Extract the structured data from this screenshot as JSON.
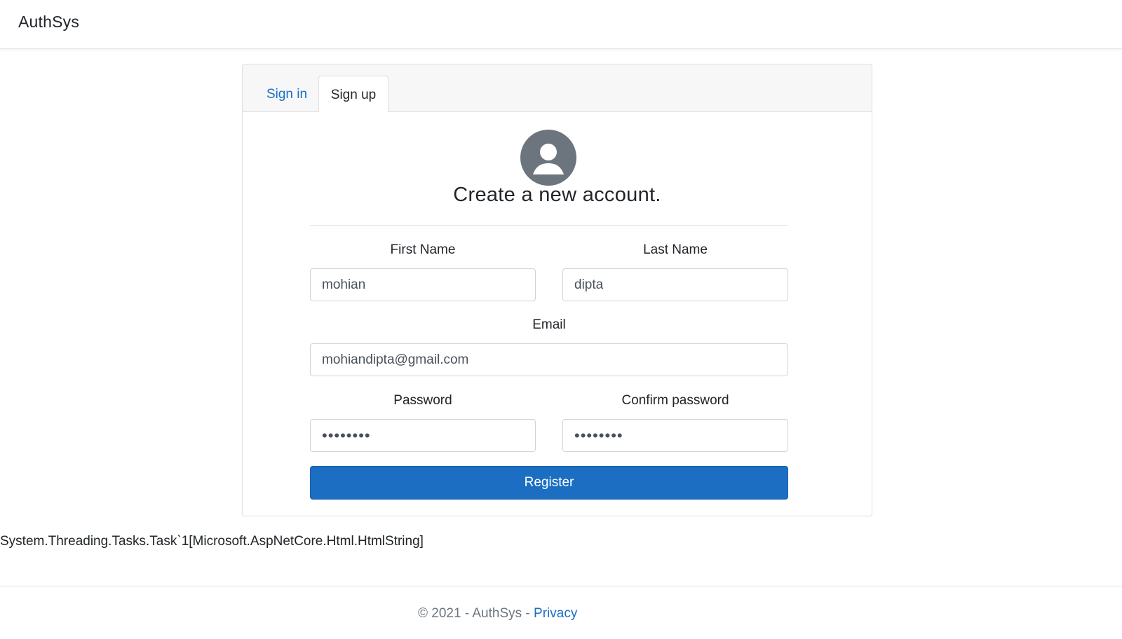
{
  "navbar": {
    "brand": "AuthSys"
  },
  "tabs": [
    {
      "label": "Sign in",
      "active": false
    },
    {
      "label": "Sign up",
      "active": true
    }
  ],
  "form": {
    "title": "Create a new account.",
    "first_name": {
      "label": "First Name",
      "value": "mohian"
    },
    "last_name": {
      "label": "Last Name",
      "value": "dipta"
    },
    "email": {
      "label": "Email",
      "value": "mohiandipta@gmail.com"
    },
    "password": {
      "label": "Password",
      "value": "••••••••"
    },
    "confirm_password": {
      "label": "Confirm password",
      "value": "••••••••"
    },
    "register_label": "Register"
  },
  "debug_text": "System.Threading.Tasks.Task`1[Microsoft.AspNetCore.Html.HtmlString]",
  "footer": {
    "copyright": "© 2021 - AuthSys - ",
    "privacy_link": "Privacy"
  },
  "icons": {
    "avatar": "user-circle-icon"
  },
  "colors": {
    "accent": "#1b6ec2",
    "link": "#1a6fc4",
    "avatar": "#6c757d"
  }
}
